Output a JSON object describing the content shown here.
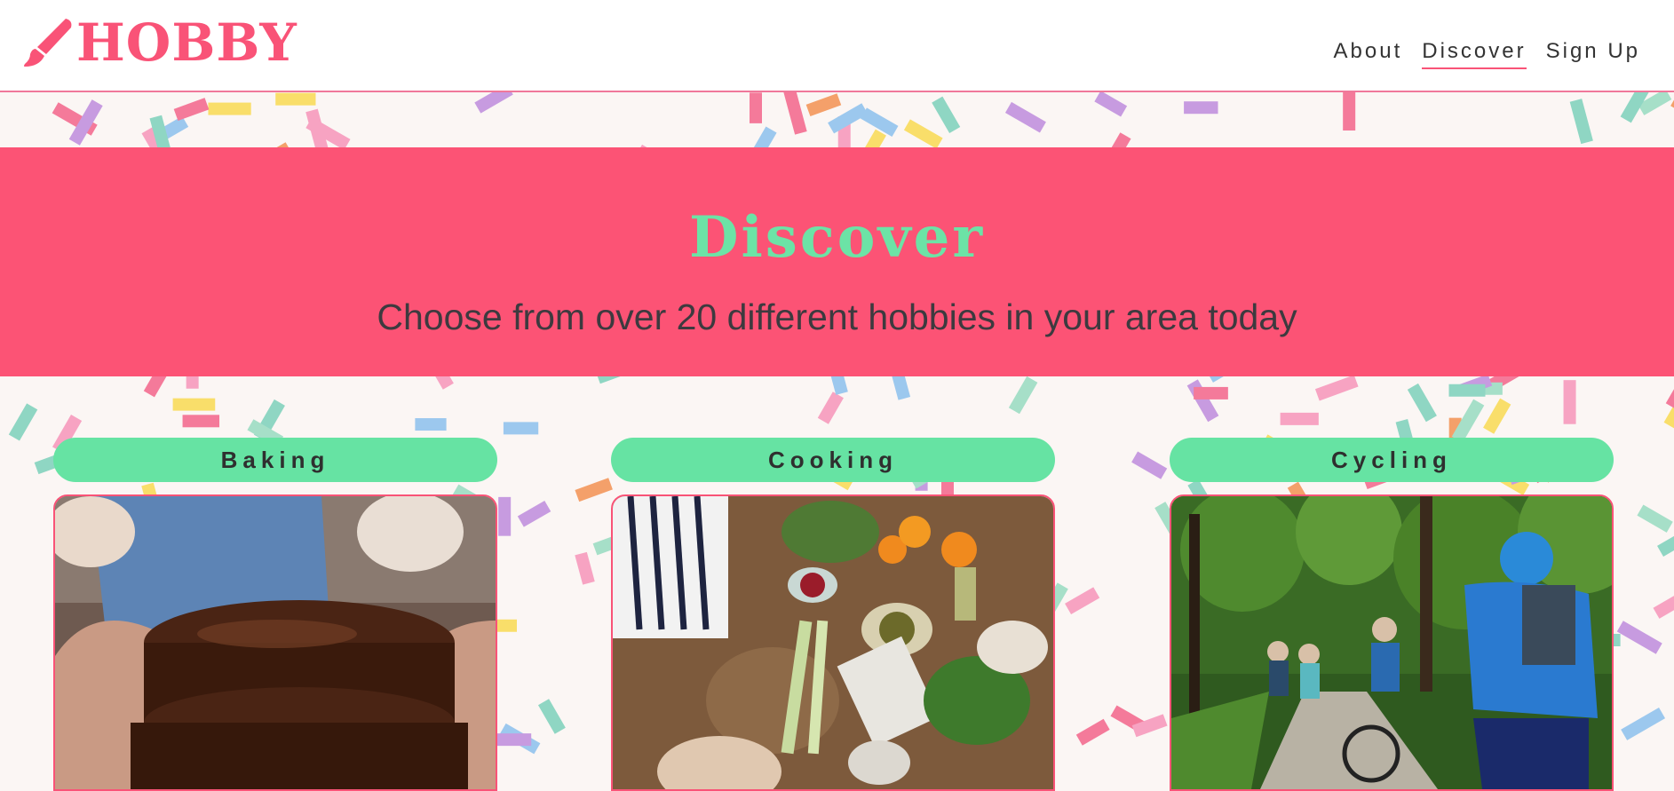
{
  "brand": {
    "name": "HOBBY",
    "logo_icon": "paintbrush-icon",
    "color": "#f95377"
  },
  "nav": [
    {
      "label": "About",
      "active": false
    },
    {
      "label": "Discover",
      "active": true
    },
    {
      "label": "Sign Up",
      "active": false
    }
  ],
  "hero": {
    "title": "Discover",
    "subtitle": "Choose from over 20 different hobbies in your area today"
  },
  "hobbies": [
    {
      "label": "Baking",
      "image": "chocolate-cake-photo"
    },
    {
      "label": "Cooking",
      "image": "cooking-table-photo"
    },
    {
      "label": "Cycling",
      "image": "cyclists-forest-photo"
    }
  ],
  "colors": {
    "accent": "#fc5375",
    "green": "#66e3a3",
    "background": "#fbf6f4"
  }
}
